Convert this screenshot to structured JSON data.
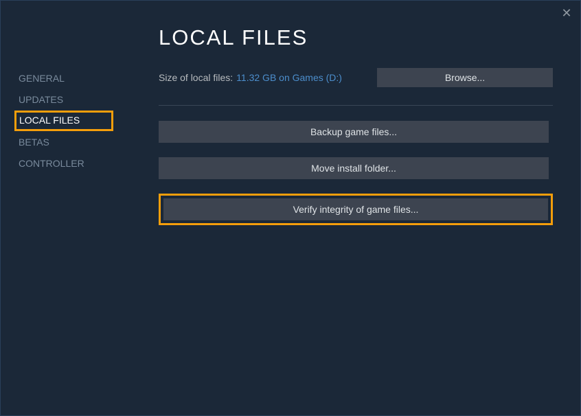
{
  "close_icon": "✕",
  "sidebar": {
    "items": [
      {
        "label": "GENERAL"
      },
      {
        "label": "UPDATES"
      },
      {
        "label": "LOCAL FILES"
      },
      {
        "label": "BETAS"
      },
      {
        "label": "CONTROLLER"
      }
    ]
  },
  "main": {
    "title": "LOCAL FILES",
    "size_label": "Size of local files:",
    "size_value": "11.32 GB on Games (D:)",
    "browse_label": "Browse...",
    "backup_label": "Backup game files...",
    "move_label": "Move install folder...",
    "verify_label": "Verify integrity of game files..."
  }
}
